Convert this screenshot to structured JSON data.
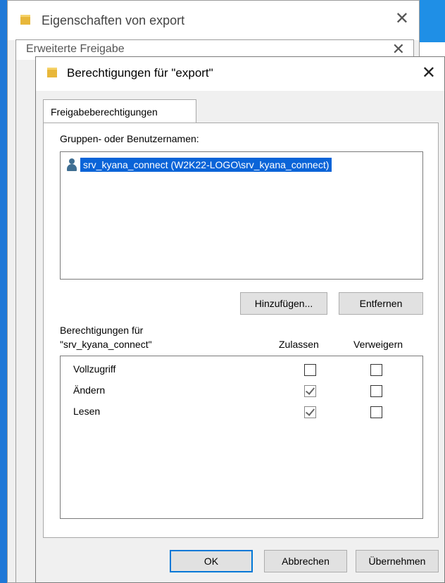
{
  "windows": {
    "properties": {
      "title": "Eigenschaften von export"
    },
    "advanced_sharing": {
      "title": "Erweiterte Freigabe"
    },
    "permissions": {
      "title": "Berechtigungen für \"export\""
    }
  },
  "tab": {
    "label": "Freigabeberechtigungen"
  },
  "groups": {
    "label": "Gruppen- oder Benutzernamen:",
    "items": [
      {
        "name": "srv_kyana_connect (W2K22-LOGO\\srv_kyana_connect)",
        "selected": true
      }
    ]
  },
  "buttons": {
    "add": "Hinzufügen...",
    "remove": "Entfernen",
    "ok": "OK",
    "cancel": "Abbrechen",
    "apply": "Übernehmen"
  },
  "permissions": {
    "label_line1": "Berechtigungen für",
    "label_line2": "\"srv_kyana_connect\"",
    "col_allow": "Zulassen",
    "col_deny": "Verweigern",
    "rows": [
      {
        "name": "Vollzugriff",
        "allow": false,
        "deny": false
      },
      {
        "name": "Ändern",
        "allow": true,
        "deny": false
      },
      {
        "name": "Lesen",
        "allow": true,
        "deny": false
      }
    ]
  },
  "icons": {
    "close": "close-icon",
    "folder": "folder-icon",
    "user": "user-icon"
  }
}
